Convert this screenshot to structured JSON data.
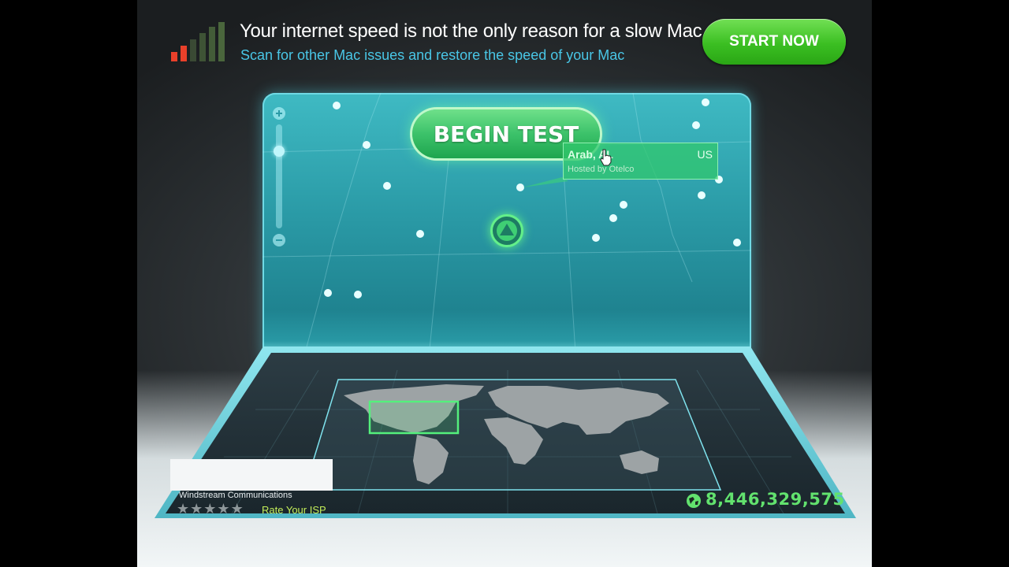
{
  "ad": {
    "headline": "Your internet speed is not the only reason for a slow Mac",
    "subline": "Scan for other Mac issues and restore the speed of your Mac",
    "cta_label": "START NOW",
    "icon": "signal-bars-icon",
    "colors": {
      "headline": "#ffffff",
      "subline": "#49c6e6",
      "cta": "#3bbf22"
    }
  },
  "map": {
    "begin_label": "BEGIN TEST",
    "server": {
      "city": "Arab, AL",
      "country": "US",
      "host": "Hosted by Otelco"
    },
    "zoom": {
      "in_icon": "plus-icon",
      "out_icon": "minus-icon"
    },
    "location_icon": "triangle-up-icon",
    "colors": {
      "screen": "#2a9aa6",
      "accent": "#3cc26a"
    }
  },
  "isp": {
    "name": "Windstream Communications",
    "rating": 0,
    "rating_max": 5,
    "rate_label": "Rate Your ISP"
  },
  "stats": {
    "tests_count": "8,446,329,575",
    "icon": "globe-icon"
  }
}
